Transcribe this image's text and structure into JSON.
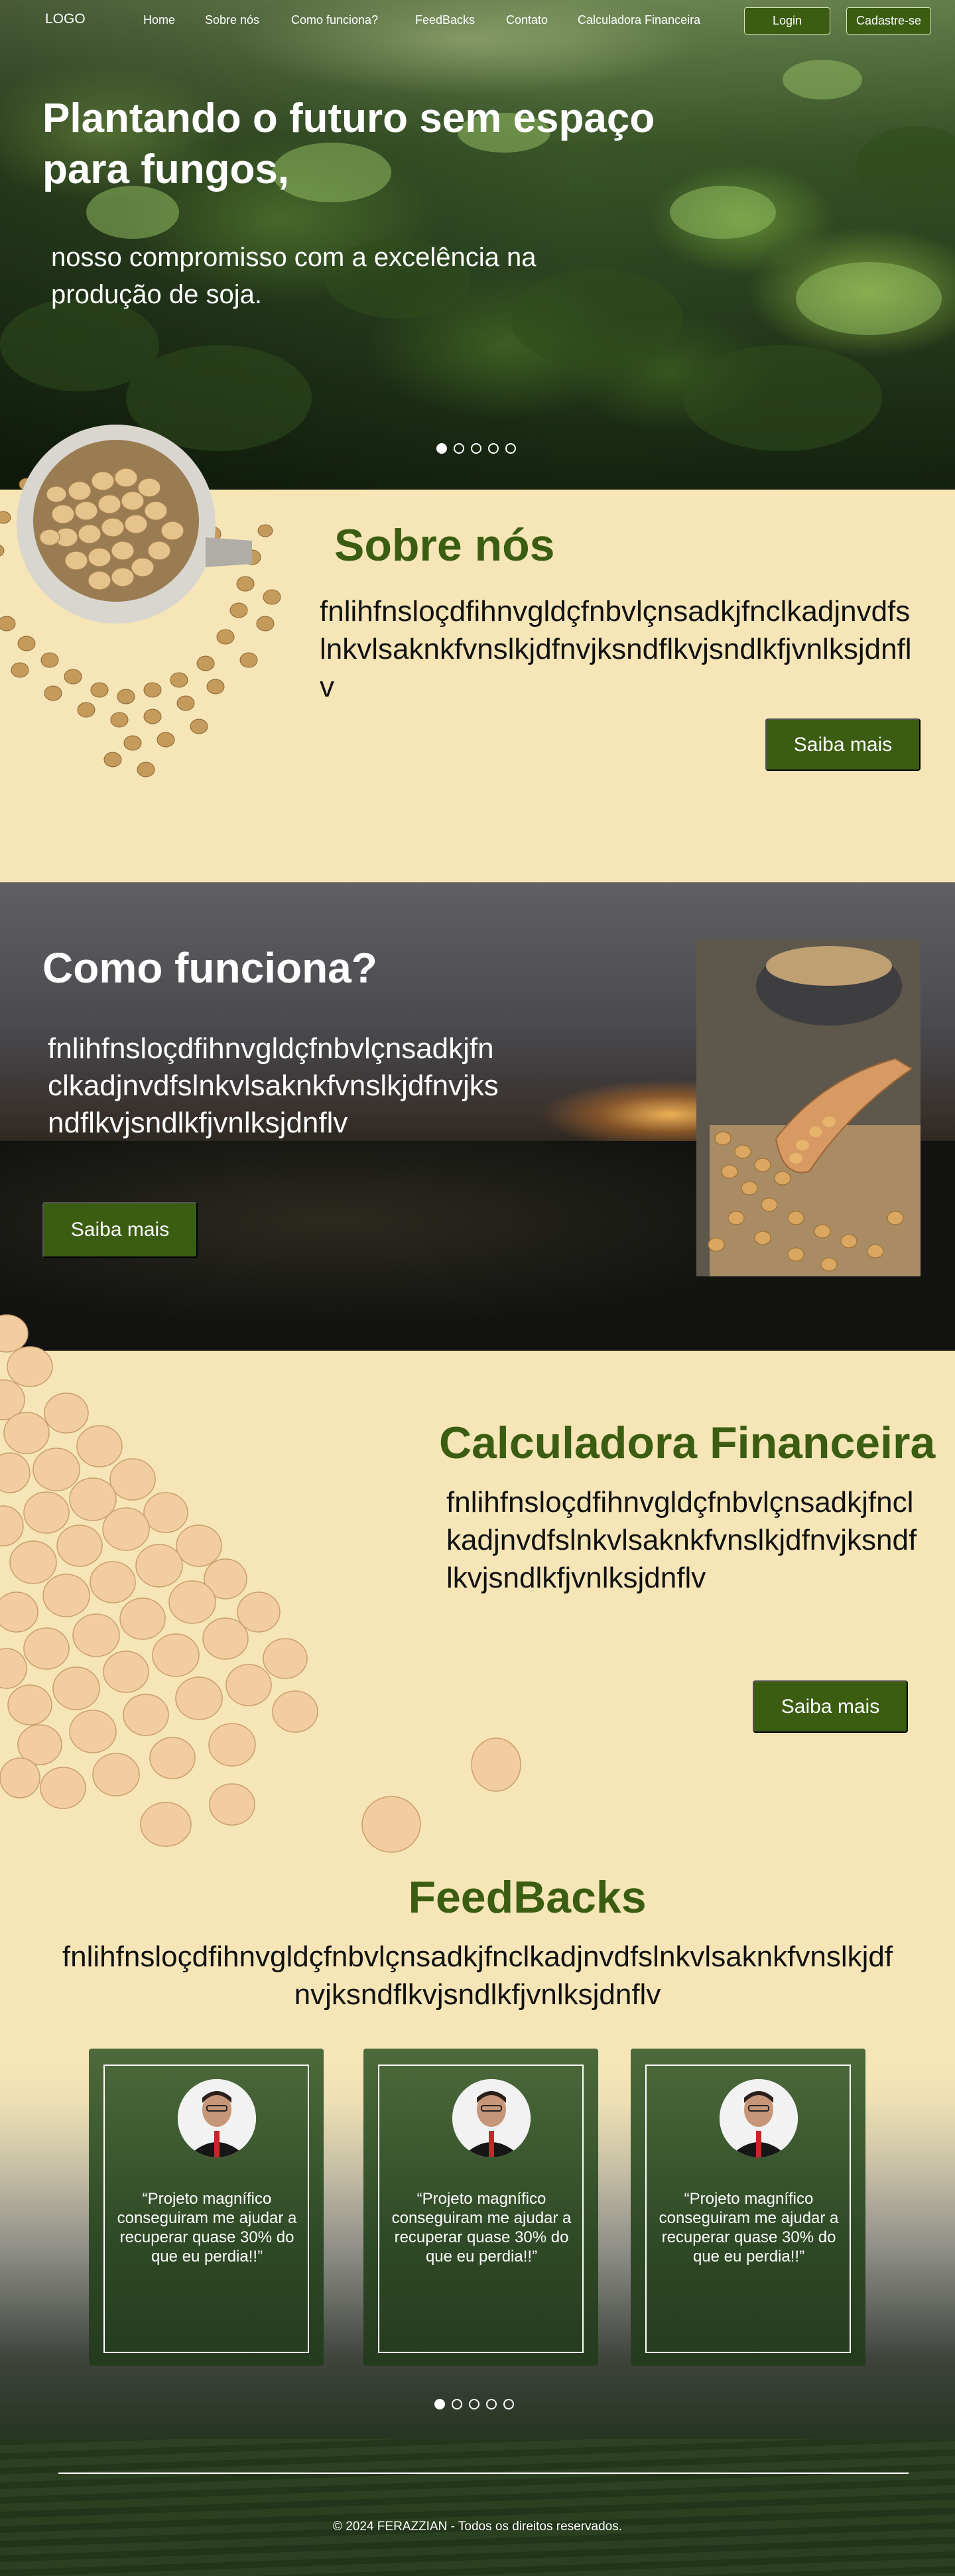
{
  "nav": {
    "logo": "LOGO",
    "links": [
      "Home",
      "Sobre nós",
      "Como funciona?",
      "FeedBacks",
      "Contato",
      "Calculadora Financeira"
    ],
    "login": "Login",
    "signup": "Cadastre-se"
  },
  "hero": {
    "title": "Plantando o futuro sem espaço para fungos,",
    "subtitle": "nosso compromisso com a excelência na produção de soja.",
    "slides": 5,
    "active_slide": 1
  },
  "sobre": {
    "title": "Sobre nós",
    "text": "fnlihfnsloçdfihnvgldçfnbvlçnsadkjfnclkadjnvdfslnkvlsaknkfvnslkjdfnvjksndflkvjsndlkfjvnlksjdnflv",
    "button": "Saiba mais"
  },
  "como": {
    "title": "Como funciona?",
    "text": "fnlihfnsloçdfihnvgldçfnbvlçnsadkjfnclkadjnvdfslnkvlsaknkfvnslkjdfnvjksndflkvjsndlkfjvnlksjdnflv",
    "button": "Saiba mais"
  },
  "calc": {
    "title": "Calculadora Financeira",
    "text": "fnlihfnsloçdfihnvgldçfnbvlçnsadkjfnclkadjnvdfslnkvlsaknkfvnslkjdfnvjksndflkvjsndlkfjvnlksjdnflv",
    "button": "Saiba mais"
  },
  "feedbacks": {
    "title": "FeedBacks",
    "text": "fnlihfnsloçdfihnvgldçfnbvlçnsadkjfnclkadjnvdfslnkvlsaknkfvnslkjdfnvjksndflkvjsndlkfjvnlksjdnflv",
    "cards": [
      {
        "quote": "“Projeto magnífico conseguiram me ajudar a recuperar quase 30% do que eu perdia!!”"
      },
      {
        "quote": "“Projeto magnífico conseguiram me ajudar a recuperar quase 30% do que eu perdia!!”"
      },
      {
        "quote": "“Projeto magnífico conseguiram me ajudar a recuperar quase 30% do que eu perdia!!”"
      }
    ],
    "slides": 5,
    "active_slide": 1
  },
  "footer": {
    "copyright": "© 2024 FERAZZIAN - Todos os direitos reservados."
  },
  "colors": {
    "brand_green": "#3b5d12",
    "cream": "#f6e5b6"
  }
}
